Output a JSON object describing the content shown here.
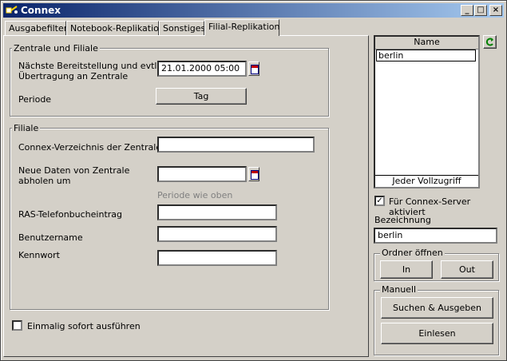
{
  "window": {
    "title": "Connex",
    "min_label": "_",
    "max_label": "□",
    "close_label": "×"
  },
  "tabs": [
    "Ausgabefilter",
    "Notebook-Replikation",
    "Sonstiges",
    "Filial-Replikation"
  ],
  "zentrale": {
    "group_label": "Zentrale und Filiale",
    "next_label_1": "Nächste Bereitstellung und evtl.",
    "next_label_2": "Übertragung an Zentrale",
    "next_value": "21.01.2000 05:00",
    "periode_label": "Periode",
    "periode_button": "Tag"
  },
  "filiale": {
    "group_label": "Filiale",
    "verzeichnis_label": "Connex-Verzeichnis der Zentrale",
    "verzeichnis_value": "",
    "neue_label_1": "Neue Daten von Zentrale",
    "neue_label_2": "abholen um",
    "neue_value": "",
    "periode_hint": "Periode wie oben",
    "ras_label": "RAS-Telefonbucheintrag",
    "ras_value": "",
    "benutzer_label": "Benutzername",
    "benutzer_value": "",
    "kennwort_label": "Kennwort",
    "kennwort_value": ""
  },
  "einmalig": {
    "label": "Einmalig sofort ausführen",
    "checked": false
  },
  "right": {
    "list_header": "Name",
    "list_items": [
      "berlin"
    ],
    "list_footer": "Jeder Vollzugriff",
    "server_label": "Für Connex-Server aktiviert",
    "server_checked": true,
    "bezeichnung_label": "Bezeichnung",
    "bezeichnung_value": "berlin",
    "ordner_label": "Ordner öffnen",
    "in_button": "In",
    "out_button": "Out",
    "manuell_label": "Manuell",
    "suchen_button": "Suchen & Ausgeben",
    "einlesen_button": "Einlesen",
    "check_mark": "✓"
  }
}
